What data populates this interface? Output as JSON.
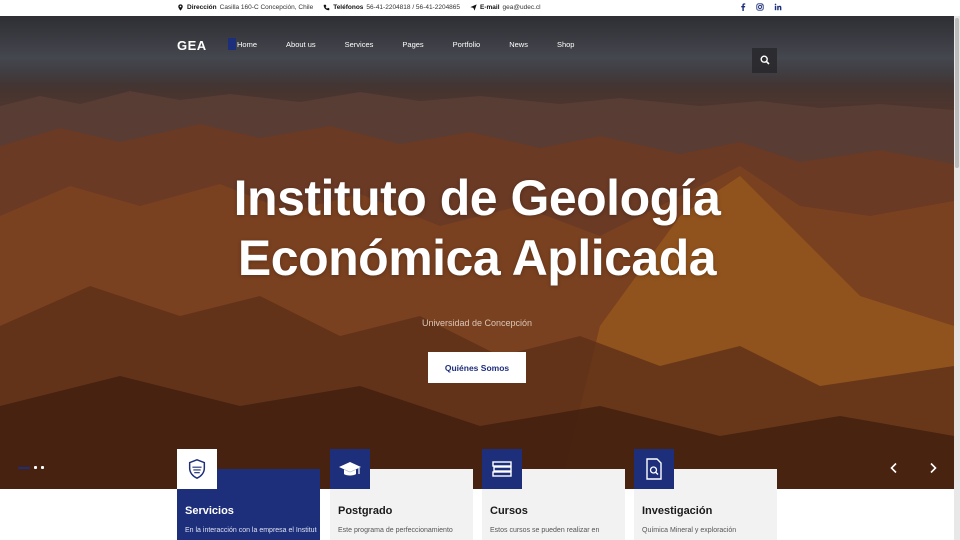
{
  "topbar": {
    "address_label": "Dirección",
    "address_value": "Casilla 160-C Concepción, Chile",
    "phone_label": "Teléfonos",
    "phone_value": "56-41-2204818 / 56-41-2204865",
    "email_label": "E-mail",
    "email_value": "gea@udec.cl",
    "social": [
      "facebook-icon",
      "instagram-icon",
      "linkedin-icon"
    ]
  },
  "nav": {
    "logo": "GEA",
    "items": [
      "Home",
      "About us",
      "Services",
      "Pages",
      "Portfolio",
      "News",
      "Shop"
    ],
    "active_index": 0
  },
  "hero": {
    "title_line1": "Instituto de Geología",
    "title_line2": "Económica Aplicada",
    "subtitle": "Universidad de Concepción",
    "button": "Quiénes Somos",
    "slides_total": 3,
    "active_slide": 1
  },
  "cards": [
    {
      "title": "Servicios",
      "text": "En la interacción con la empresa el Instituto GEA",
      "icon": "shield-badge-icon"
    },
    {
      "title": "Postgrado",
      "text": "Este programa de perfeccionamiento",
      "icon": "graduation-cap-icon"
    },
    {
      "title": "Cursos",
      "text": "Estos cursos se pueden realizar en",
      "icon": "books-icon"
    },
    {
      "title": "Investigación",
      "text": "Química Mineral y exploración",
      "icon": "document-search-icon"
    }
  ],
  "colors": {
    "brand": "#1d2e7a",
    "hero_overlay": "#3a2014"
  }
}
